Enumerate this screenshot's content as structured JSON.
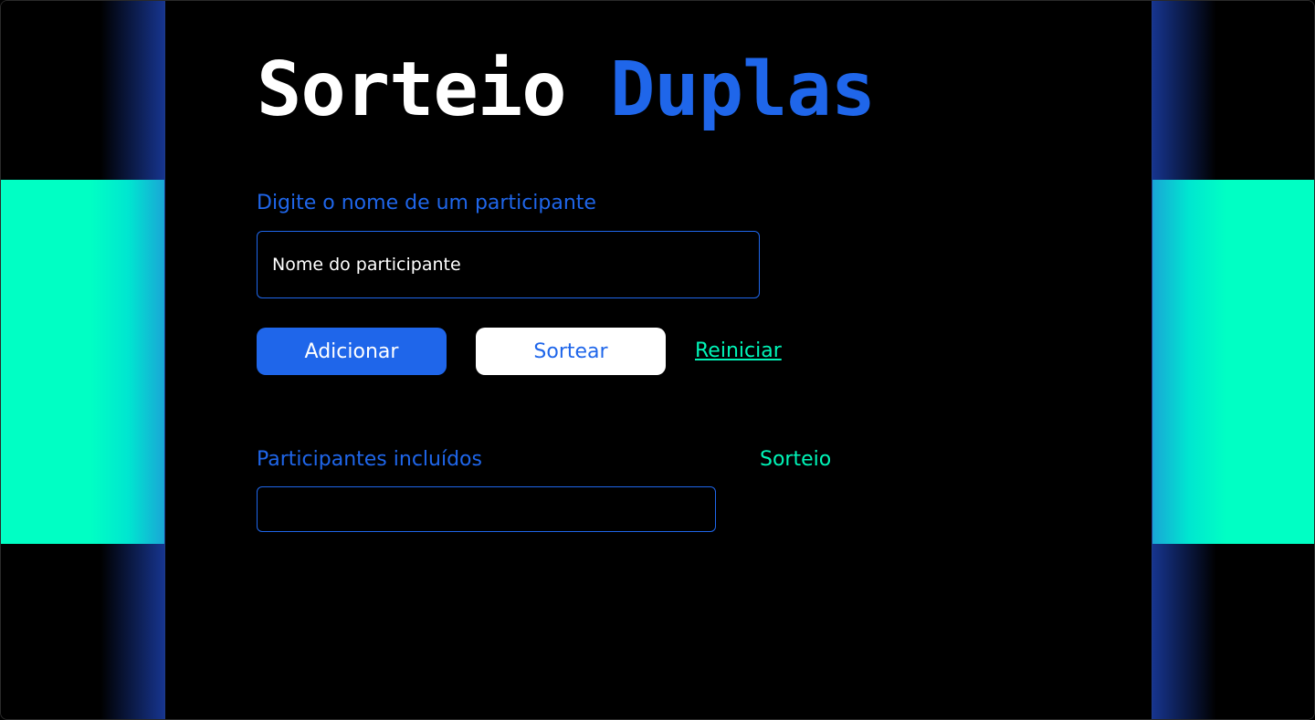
{
  "header": {
    "title_part1": "Sorteio",
    "title_part2": "Duplas"
  },
  "form": {
    "field_label": "Digite o nome de um participante",
    "input_placeholder": "Nome do participante",
    "input_value": ""
  },
  "actions": {
    "add_label": "Adicionar",
    "draw_label": "Sortear",
    "reset_label": "Reiniciar"
  },
  "participants": {
    "label": "Participantes incluídos",
    "items": []
  },
  "result": {
    "label": "Sorteio",
    "pairs": []
  },
  "colors": {
    "background": "#000000",
    "primary_blue": "#1f66ea",
    "accent_green": "#00f5b8",
    "side_band": "#00ffc4",
    "white": "#ffffff"
  }
}
